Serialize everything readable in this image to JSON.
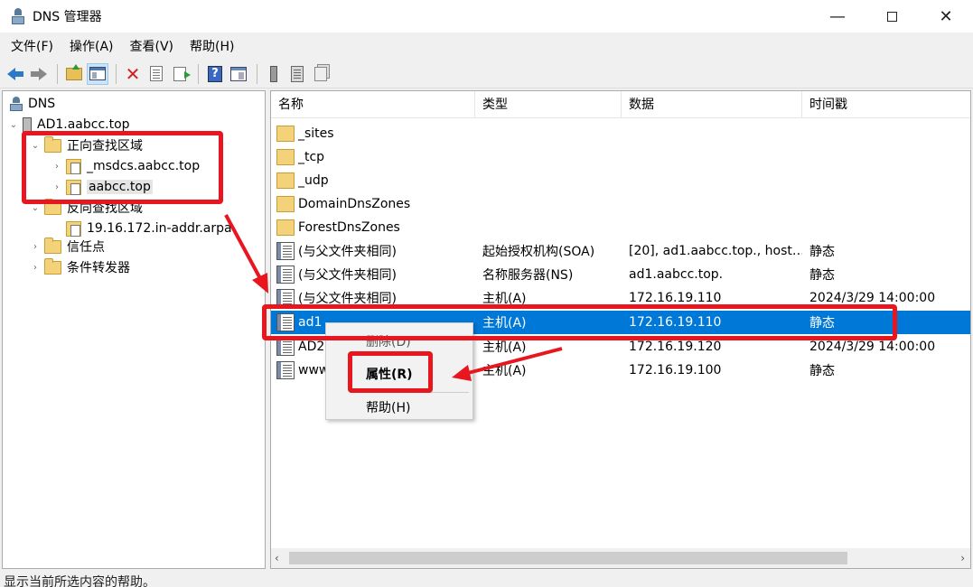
{
  "window": {
    "title": "DNS 管理器",
    "minimize_label": "—",
    "close_label": "✕"
  },
  "menu": [
    "文件(F)",
    "操作(A)",
    "查看(V)",
    "帮助(H)"
  ],
  "tree": {
    "root": "DNS",
    "server": "AD1.aabcc.top",
    "forward_zones": "正向查找区域",
    "msdcs_zone": "_msdcs.aabcc.top",
    "aabcc_zone": "aabcc.top",
    "reverse_zones": "反向查找区域",
    "reverse_zone_item": "19.16.172.in-addr.arpa",
    "trust_points": "信任点",
    "conditional_forwarders": "条件转发器"
  },
  "columns": [
    "名称",
    "类型",
    "数据",
    "时间戳"
  ],
  "rows": [
    {
      "name": "_sites",
      "type": "",
      "data": "",
      "time": "",
      "icon": "folder-icon"
    },
    {
      "name": "_tcp",
      "type": "",
      "data": "",
      "time": "",
      "icon": "folder-icon"
    },
    {
      "name": "_udp",
      "type": "",
      "data": "",
      "time": "",
      "icon": "folder-icon"
    },
    {
      "name": "DomainDnsZones",
      "type": "",
      "data": "",
      "time": "",
      "icon": "folder-icon"
    },
    {
      "name": "ForestDnsZones",
      "type": "",
      "data": "",
      "time": "",
      "icon": "folder-icon"
    },
    {
      "name": "(与父文件夹相同)",
      "type": "起始授权机构(SOA)",
      "data": "[20], ad1.aabcc.top., host…",
      "time": "静态",
      "icon": "record-icon"
    },
    {
      "name": "(与父文件夹相同)",
      "type": "名称服务器(NS)",
      "data": "ad1.aabcc.top.",
      "time": "静态",
      "icon": "record-icon"
    },
    {
      "name": "(与父文件夹相同)",
      "type": "主机(A)",
      "data": "172.16.19.110",
      "time": "2024/3/29 14:00:00",
      "icon": "record-icon"
    },
    {
      "name": "ad1",
      "type": "主机(A)",
      "data": "172.16.19.110",
      "time": "静态",
      "icon": "record-icon"
    },
    {
      "name": "AD2",
      "type": "主机(A)",
      "data": "172.16.19.120",
      "time": "2024/3/29 14:00:00",
      "icon": "record-icon"
    },
    {
      "name": "www",
      "type": "主机(A)",
      "data": "172.16.19.100",
      "time": "静态",
      "icon": "record-icon"
    }
  ],
  "context_menu": {
    "delete": "删除(D)",
    "properties": "属性(R)",
    "help": "帮助(H)"
  },
  "status_text": "显示当前所选内容的帮助。",
  "colors": {
    "selection": "#0078d7",
    "annotation": "#e8161e"
  }
}
